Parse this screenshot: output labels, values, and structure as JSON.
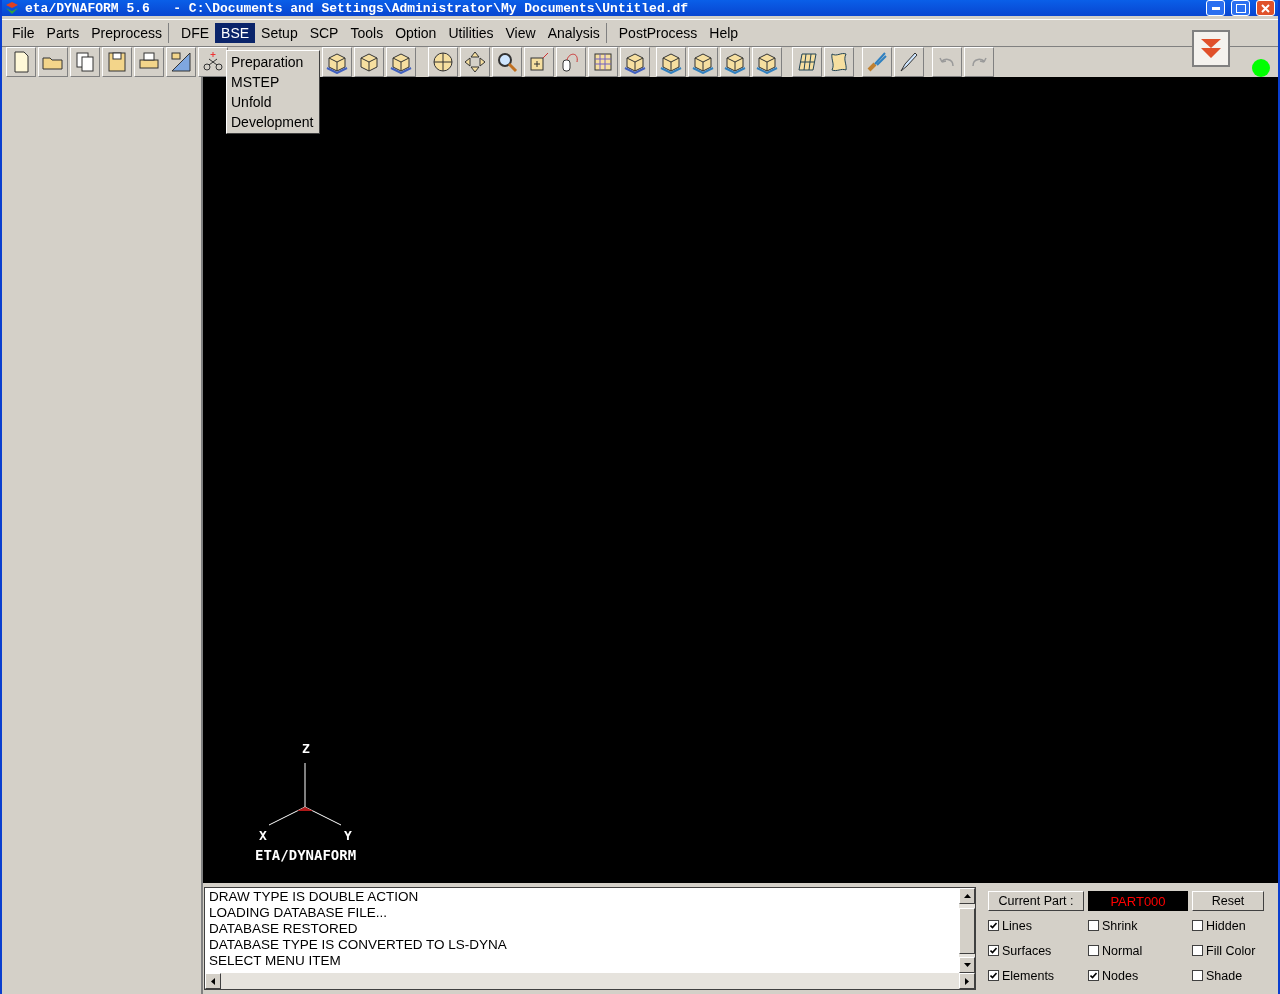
{
  "window": {
    "title": "eta/DYNAFORM 5.6   - C:\\Documents and Settings\\Administrator\\My Documents\\Untitled.df"
  },
  "menu": [
    {
      "label": "File",
      "selected": false
    },
    {
      "label": "Parts",
      "selected": false
    },
    {
      "label": "Preprocess",
      "selected": false
    },
    {
      "label": "DFE",
      "selected": false
    },
    {
      "label": "BSE",
      "selected": true
    },
    {
      "label": "Setup",
      "selected": false
    },
    {
      "label": "SCP",
      "selected": false
    },
    {
      "label": "Tools",
      "selected": false
    },
    {
      "label": "Option",
      "selected": false
    },
    {
      "label": "Utilities",
      "selected": false
    },
    {
      "label": "View",
      "selected": false
    },
    {
      "label": "Analysis",
      "selected": false
    },
    {
      "label": "PostProcess",
      "selected": false
    },
    {
      "label": "Help",
      "selected": false
    }
  ],
  "dropdown": [
    "Preparation",
    "MSTEP",
    "Unfold",
    "Development"
  ],
  "viewport": {
    "axes": {
      "z": "Z",
      "x": "X",
      "y": "Y"
    },
    "brand": "ETA/DYNAFORM"
  },
  "log": [
    "DRAW TYPE IS DOUBLE ACTION",
    "LOADING DATABASE FILE...",
    "DATABASE RESTORED",
    "DATABASE TYPE IS CONVERTED TO LS-DYNA",
    "SELECT MENU ITEM"
  ],
  "display_panel": {
    "current_part_button": "Current Part :",
    "current_part": "PART000",
    "reset_button": "Reset",
    "options": [
      {
        "label": "Lines",
        "checked": true
      },
      {
        "label": "Shrink",
        "checked": false
      },
      {
        "label": "Hidden",
        "checked": false
      },
      {
        "label": "Surfaces",
        "checked": true
      },
      {
        "label": "Normal",
        "checked": false
      },
      {
        "label": "Fill Color",
        "checked": false
      },
      {
        "label": "Elements",
        "checked": true
      },
      {
        "label": "Nodes",
        "checked": true
      },
      {
        "label": "Shade",
        "checked": false
      }
    ]
  }
}
